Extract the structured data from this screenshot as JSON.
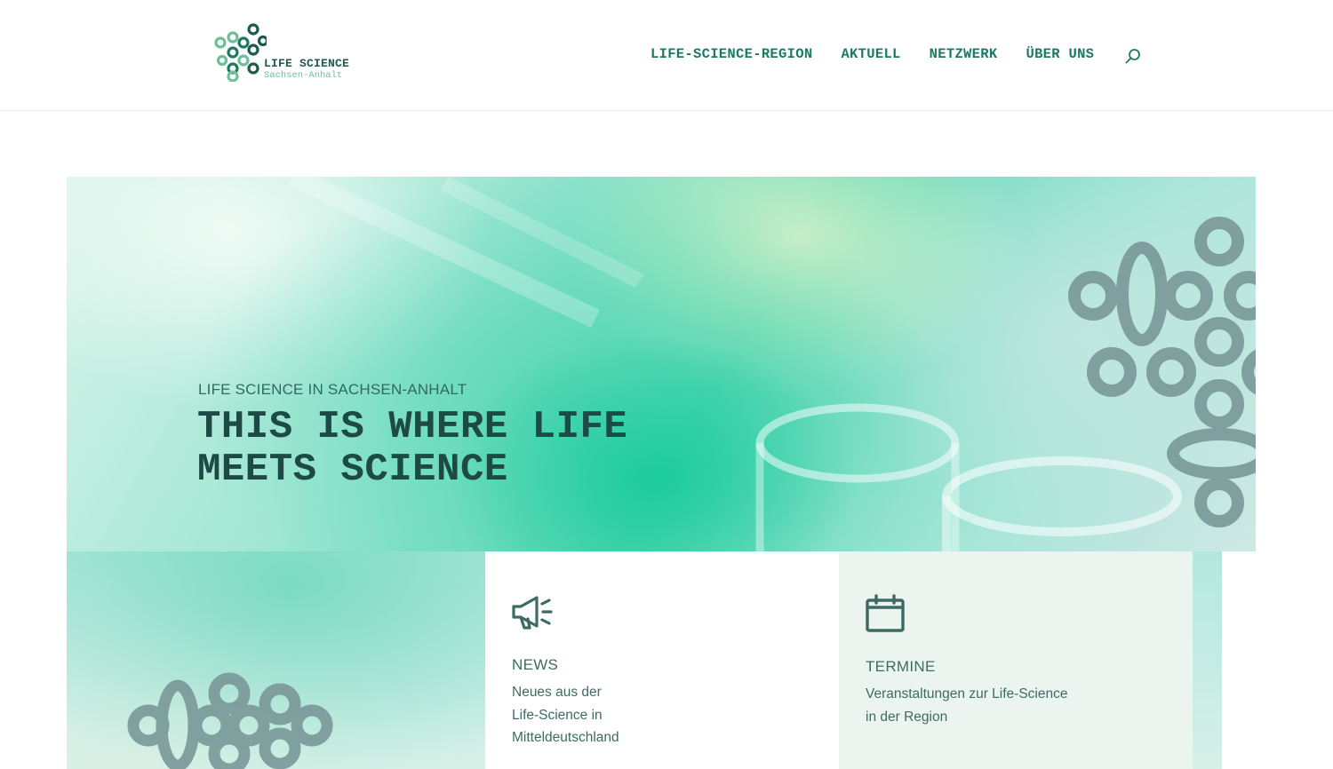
{
  "brand": {
    "name_line1": "LIFE SCIENCE",
    "name_line2": "Sachsen-Anhalt",
    "colors": {
      "dark": "#1f5a4f",
      "accent": "#1c7a62",
      "light": "#6fbf98"
    }
  },
  "nav": {
    "items": [
      {
        "label": "LIFE-SCIENCE-REGION"
      },
      {
        "label": "AKTUELL"
      },
      {
        "label": "NETZWERK"
      },
      {
        "label": "ÜBER UNS"
      }
    ],
    "search_icon": "search-icon"
  },
  "hero": {
    "eyebrow": "LIFE SCIENCE IN SACHSEN-ANHALT",
    "headline_line1": "THIS IS WHERE LIFE",
    "headline_line2": "MEETS SCIENCE"
  },
  "cards": [
    {
      "icon": "megaphone-icon",
      "title": "NEWS",
      "text_lines": [
        "Neues aus der",
        "Life-Science in",
        "Mitteldeutschland"
      ]
    },
    {
      "icon": "calendar-icon",
      "title": "TERMINE",
      "text_lines": [
        "Veranstaltungen zur Life-Science",
        "in der Region"
      ]
    }
  ]
}
